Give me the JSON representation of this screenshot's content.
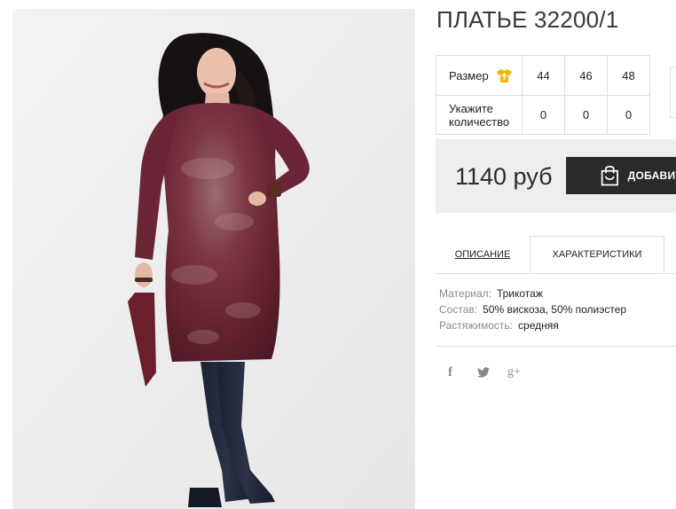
{
  "product": {
    "title": "ПЛАТЬЕ 32200/1",
    "image_alt": "Платье 32200/1"
  },
  "size_table": {
    "size_label": "Размер",
    "size_icon": "tshirt-icon",
    "qty_label_line1": "Укажите",
    "qty_label_line2": "количество",
    "sizes": [
      "44",
      "46",
      "48"
    ],
    "quantities": [
      "0",
      "0",
      "0"
    ]
  },
  "purchase": {
    "price": "1140 руб",
    "add_button_label": "ДОБАВИТЬ",
    "add_button_icon": "shopping-bag-icon"
  },
  "tabs": {
    "description": "ОПИСАНИЕ",
    "characteristics": "ХАРАКТЕРИСТИКИ",
    "active": "characteristics"
  },
  "characteristics": [
    {
      "key": "Материал:",
      "value": "Трикотаж"
    },
    {
      "key": "Состав:",
      "value": "50% вискоза, 50% полиэстер"
    },
    {
      "key": "Растяжимость:",
      "value": "средняя"
    }
  ],
  "social": {
    "facebook": "f",
    "twitter_icon": "twitter-icon",
    "google_plus": "g+"
  },
  "colors": {
    "accent_button": "#2a2a2a",
    "panel_bg": "#eeeeee",
    "size_icon": "#f5b400",
    "dress": "#6b2734"
  }
}
